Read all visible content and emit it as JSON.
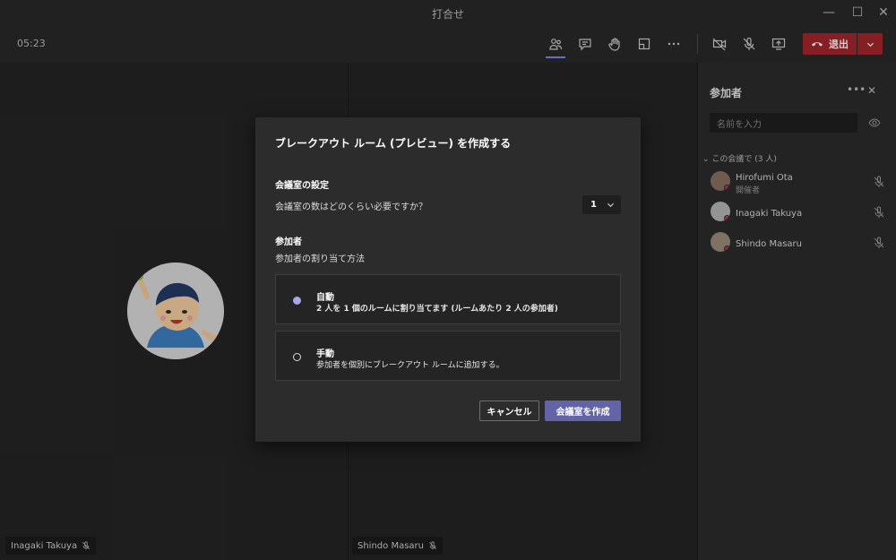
{
  "window": {
    "title": "打合せ",
    "controls": {
      "minimize": "—",
      "maximize": "☐",
      "close": "✕"
    }
  },
  "toolbar": {
    "timer": "05:23",
    "icons": [
      "participants-icon",
      "chat-icon",
      "raise-hand-icon",
      "breakout-rooms-icon",
      "more-icon",
      "camera-off-icon",
      "mic-off-icon",
      "share-screen-icon"
    ],
    "leave_label": "退出",
    "leave_color": "#a4262c"
  },
  "stage": {
    "tiles": [
      {
        "name": "Inagaki Takuya"
      },
      {
        "name": "Shindo Masaru"
      }
    ]
  },
  "participants_panel": {
    "title": "参加者",
    "search_placeholder": "名前を入力",
    "section_label": "⌄ この会議で (3 人)",
    "people": [
      {
        "name": "Hirofumi Ota",
        "role": "開催者"
      },
      {
        "name": "Inagaki Takuya",
        "role": ""
      },
      {
        "name": "Shindo Masaru",
        "role": ""
      }
    ]
  },
  "dialog": {
    "title": "ブレークアウト ルーム (プレビュー) を作成する",
    "rooms_section": {
      "heading": "会議室の設定",
      "question": "会議室の数はどのくらい必要ですか？",
      "selected_count": "1"
    },
    "participants_section": {
      "heading": "参加者",
      "subheading": "参加者の割り当て方法"
    },
    "options": [
      {
        "title": "自動",
        "description": "2 人を 1 個のルームに割り当てます (ルームあたり 2 人の参加者)",
        "selected": true
      },
      {
        "title": "手動",
        "description": "参加者を個別にブレークアウト ルームに追加する。",
        "selected": false
      }
    ],
    "cancel_label": "キャンセル",
    "create_label": "会議室を作成",
    "accent_color": "#6264a7"
  }
}
